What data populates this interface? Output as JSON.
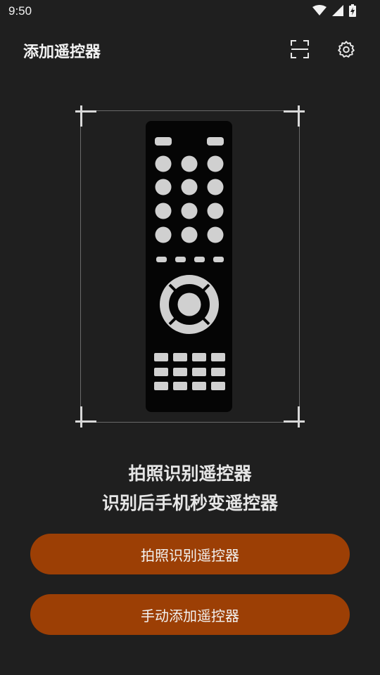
{
  "status_bar": {
    "time": "9:50",
    "icons": [
      "wifi-icon",
      "signal-icon",
      "battery-icon"
    ]
  },
  "app_bar": {
    "title": "添加遥控器",
    "icons": [
      "scan-icon",
      "settings-icon"
    ]
  },
  "illustration": {
    "icon": "remote-control-icon"
  },
  "caption": {
    "line1": "拍照识别遥控器",
    "line2": "识别后手机秒变遥控器"
  },
  "actions": {
    "photo_button": "拍照识别遥控器",
    "manual_button": "手动添加遥控器"
  },
  "colors": {
    "background": "#1f1f1f",
    "button": "#9c3f05",
    "remote_body": "#050505",
    "remote_keys": "#d0d0d0"
  }
}
